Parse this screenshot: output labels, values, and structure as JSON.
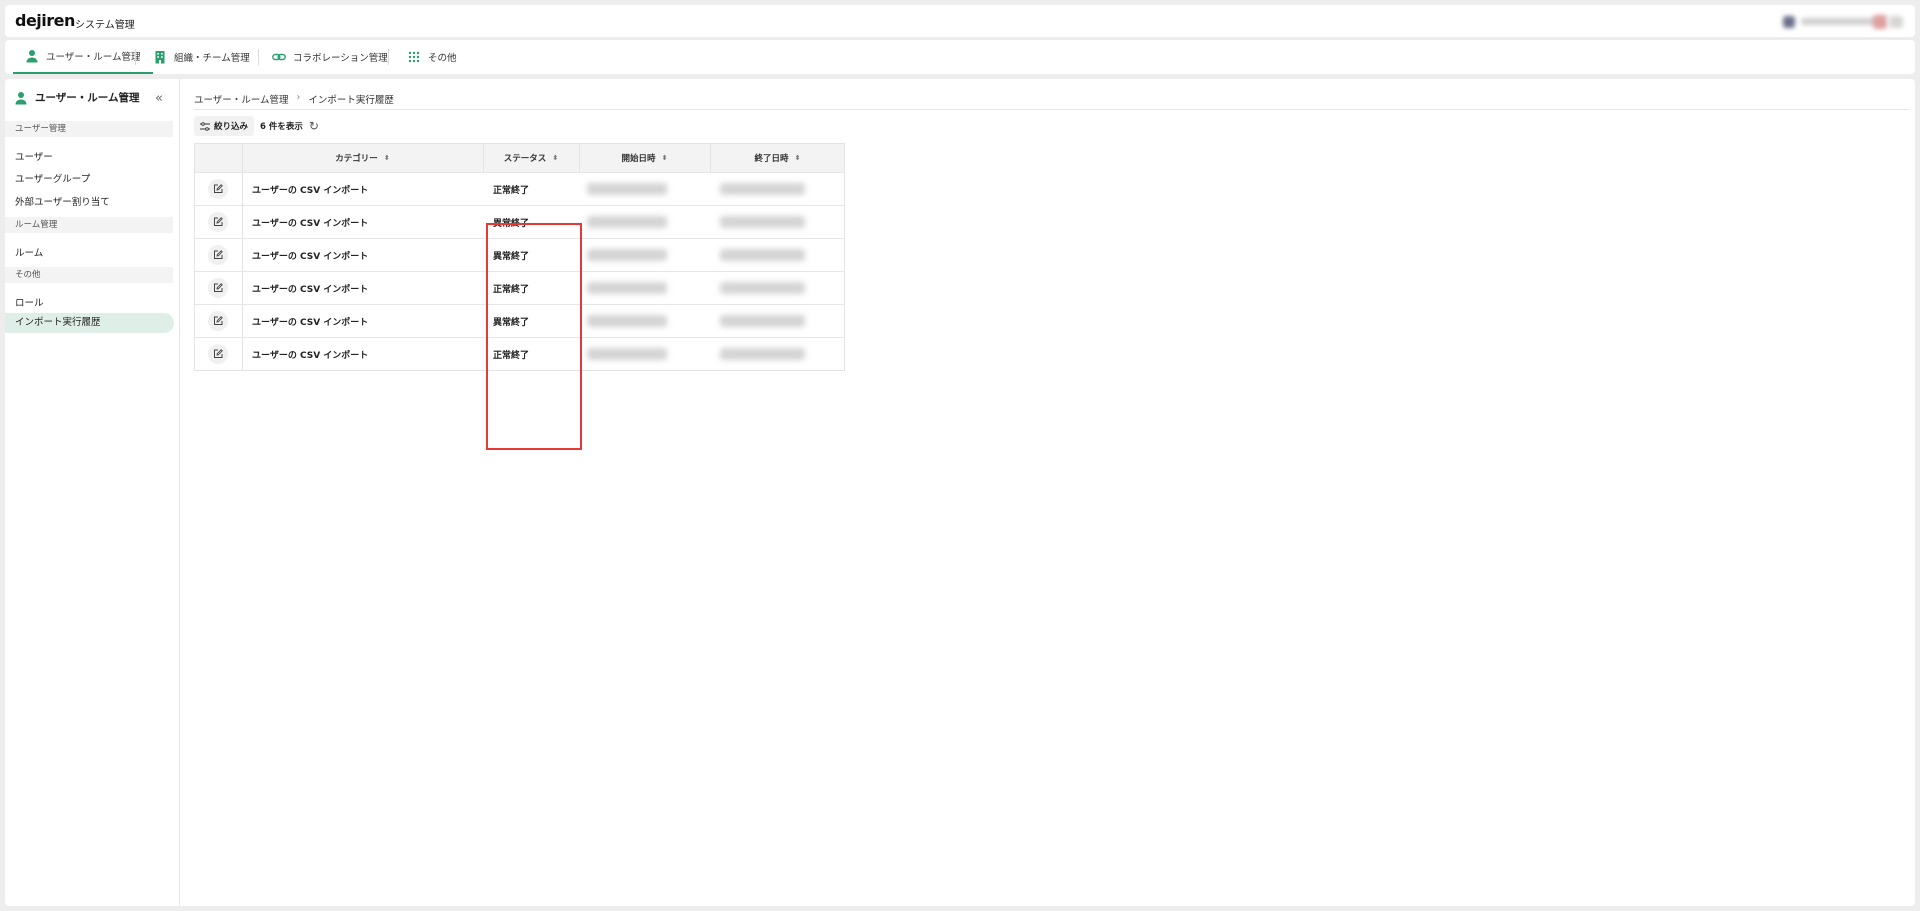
{
  "header": {
    "logo": "dejiren",
    "app_title": "システム管理"
  },
  "topnav": {
    "items": [
      {
        "label": "ユーザー・ルーム管理",
        "icon": "person-icon",
        "active": true
      },
      {
        "label": "組織・チーム管理",
        "icon": "building-icon",
        "active": false
      },
      {
        "label": "コラボレーション管理",
        "icon": "link-icon",
        "active": false
      },
      {
        "label": "その他",
        "icon": "grid-icon",
        "active": false
      }
    ]
  },
  "sidebar": {
    "title": "ユーザー・ルーム管理",
    "collapse_icon": "double-chevron-left-icon",
    "sections": [
      {
        "label": "ユーザー管理",
        "items": [
          "ユーザー",
          "ユーザーグループ",
          "外部ユーザー割り当て"
        ]
      },
      {
        "label": "ルーム管理",
        "items": [
          "ルーム"
        ]
      },
      {
        "label": "その他",
        "items": [
          "ロール",
          "インポート実行履歴"
        ]
      }
    ],
    "active_item": "インポート実行履歴"
  },
  "breadcrumb": {
    "items": [
      "ユーザー・ルーム管理",
      "インポート実行履歴"
    ],
    "separator": "›"
  },
  "toolbar": {
    "filter_label": "絞り込み",
    "count_text": "6 件を表示",
    "refresh_icon": "refresh-icon"
  },
  "table": {
    "columns": [
      "カテゴリー",
      "ステータス",
      "開始日時",
      "終了日時"
    ],
    "rows": [
      {
        "category": "ユーザーの CSV インポート",
        "status": "正常終了"
      },
      {
        "category": "ユーザーの CSV インポート",
        "status": "異常終了"
      },
      {
        "category": "ユーザーの CSV インポート",
        "status": "異常終了"
      },
      {
        "category": "ユーザーの CSV インポート",
        "status": "正常終了"
      },
      {
        "category": "ユーザーの CSV インポート",
        "status": "異常終了"
      },
      {
        "category": "ユーザーの CSV インポート",
        "status": "正常終了"
      }
    ]
  },
  "colors": {
    "accent": "#2b9e6e",
    "highlight": "#e53935",
    "active_bg": "#dfeee7"
  }
}
